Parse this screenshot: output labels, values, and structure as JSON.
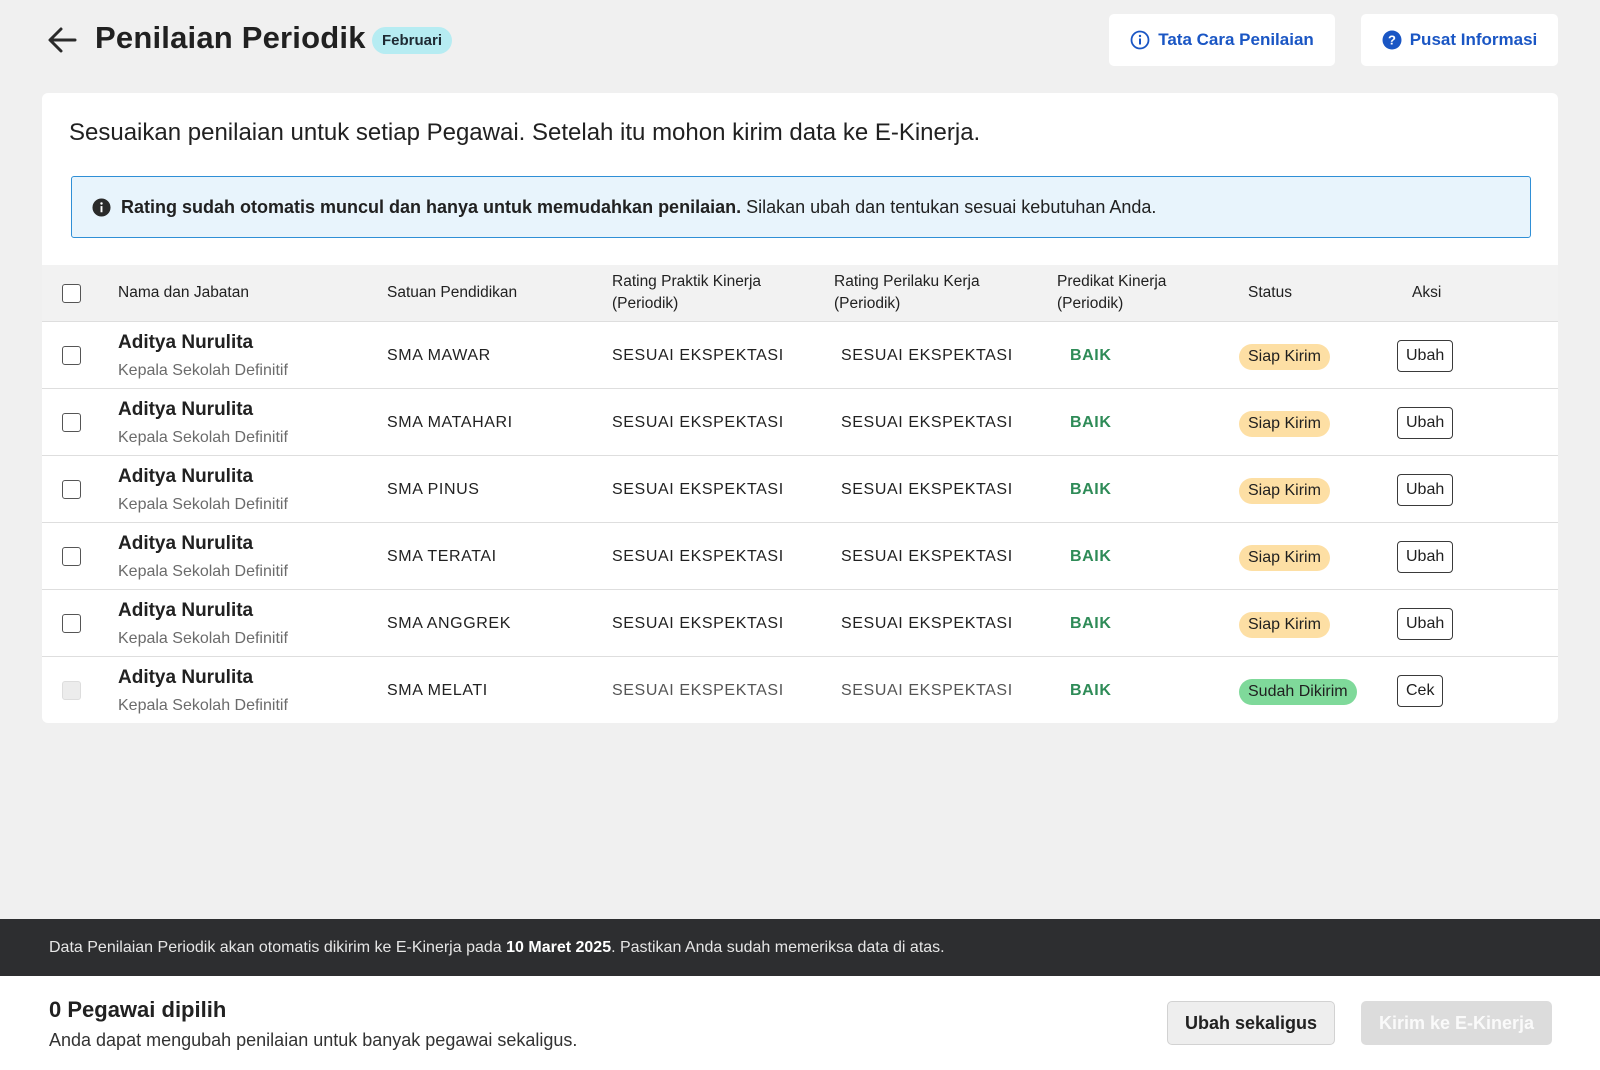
{
  "header": {
    "title": "Penilaian Periodik",
    "month_badge": "Februari",
    "tata_cara_label": "Tata Cara Penilaian",
    "pusat_info_label": "Pusat Informasi"
  },
  "card": {
    "title": "Sesuaikan penilaian untuk setiap Pegawai. Setelah itu mohon kirim data ke E-Kinerja.",
    "info_bold": "Rating sudah otomatis muncul dan hanya untuk memudahkan penilaian.",
    "info_text": " Silakan ubah dan tentukan sesuai kebutuhan Anda."
  },
  "table": {
    "columns": {
      "name": "Nama dan Jabatan",
      "school": "Satuan Pendidikan",
      "praktik_1": "Rating Praktik Kinerja",
      "praktik_2": "(Periodik)",
      "perilaku_1": "Rating Perilaku Kerja",
      "perilaku_2": "(Periodik)",
      "predikat_1": "Predikat Kinerja",
      "predikat_2": "(Periodik)",
      "status": "Status",
      "aksi": "Aksi"
    },
    "rows": [
      {
        "name": "Aditya Nurulita",
        "role": "Kepala Sekolah Definitif",
        "school": "SMA MAWAR",
        "praktik": "SESUAI EKSPEKTASI",
        "perilaku": "SESUAI EKSPEKTASI",
        "predikat": "BAIK",
        "status": "Siap Kirim",
        "action": "Ubah"
      },
      {
        "name": "Aditya Nurulita",
        "role": "Kepala Sekolah Definitif",
        "school": "SMA MATAHARI",
        "praktik": "SESUAI EKSPEKTASI",
        "perilaku": "SESUAI EKSPEKTASI",
        "predikat": "BAIK",
        "status": "Siap Kirim",
        "action": "Ubah"
      },
      {
        "name": "Aditya Nurulita",
        "role": "Kepala Sekolah Definitif",
        "school": "SMA PINUS",
        "praktik": "SESUAI EKSPEKTASI",
        "perilaku": "SESUAI EKSPEKTASI",
        "predikat": "BAIK",
        "status": "Siap Kirim",
        "action": "Ubah"
      },
      {
        "name": "Aditya Nurulita",
        "role": "Kepala Sekolah Definitif",
        "school": "SMA TERATAI",
        "praktik": "SESUAI EKSPEKTASI",
        "perilaku": "SESUAI EKSPEKTASI",
        "predikat": "BAIK",
        "status": "Siap Kirim",
        "action": "Ubah"
      },
      {
        "name": "Aditya Nurulita",
        "role": "Kepala Sekolah Definitif",
        "school": "SMA ANGGREK",
        "praktik": "SESUAI EKSPEKTASI",
        "perilaku": "SESUAI EKSPEKTASI",
        "predikat": "BAIK",
        "status": "Siap Kirim",
        "action": "Ubah"
      },
      {
        "name": "Aditya Nurulita",
        "role": "Kepala Sekolah Definitif",
        "school": "SMA MELATI",
        "praktik": "SESUAI EKSPEKTASI",
        "perilaku": "SESUAI EKSPEKTASI",
        "predikat": "BAIK",
        "status": "Sudah Dikirim",
        "action": "Cek"
      }
    ]
  },
  "notice": {
    "text_1": "Data Penilaian Periodik akan otomatis dikirim ke E-Kinerja pada ",
    "date": "10 Maret 2025",
    "text_2": ". Pastikan Anda sudah memeriksa data di atas."
  },
  "footer": {
    "selected": "0 Pegawai dipilih",
    "hint": "Anda dapat mengubah penilaian untuk banyak pegawai sekaligus.",
    "bulk_label": "Ubah sekaligus",
    "send_label": "Kirim ke E-Kinerja"
  },
  "colors": {
    "accent_blue": "#1a56c4",
    "badge_month": "#b6ecf2",
    "status_siap": "#fddfa4",
    "status_sudah": "#7fd99a",
    "predikat_green": "#2e8b57"
  }
}
